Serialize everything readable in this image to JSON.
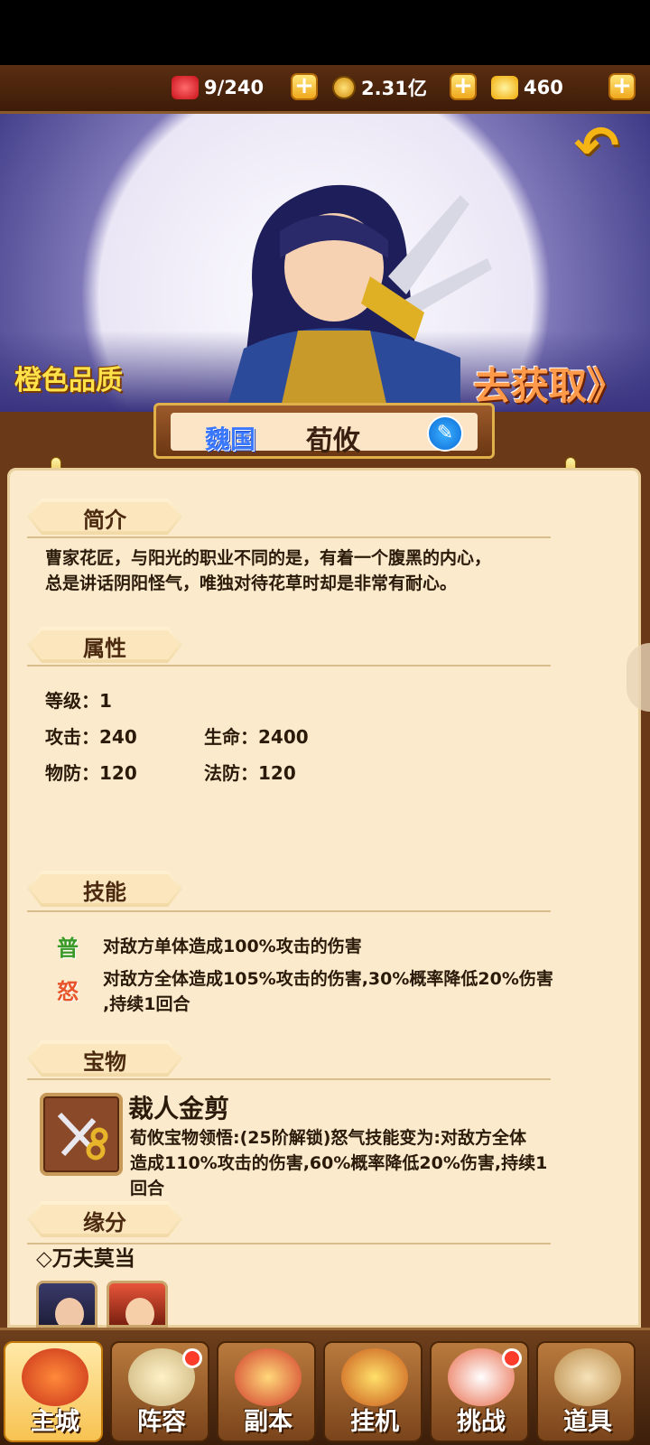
{
  "resources": [
    {
      "icon": "stamina-icon",
      "value": "9/240",
      "color": "#e8232a"
    },
    {
      "icon": "coin-icon",
      "value": "2.31亿",
      "color": "#f2b21a"
    },
    {
      "icon": "ingot-icon",
      "value": "460",
      "color": "#ffc414"
    }
  ],
  "hero": {
    "quality": "橙色品质",
    "get_link": "去获取》",
    "nation": "魏国",
    "name": "荀攸"
  },
  "sections": {
    "intro": "简介",
    "attributes": "属性",
    "skills": "技能",
    "treasure": "宝物",
    "fate": "缘分"
  },
  "intro": {
    "line1": "曹家花匠，与阳光的职业不同的是，有着一个腹黑的内心，",
    "line2": "总是讲话阴阳怪气，唯独对待花草时却是非常有耐心。"
  },
  "attributes": {
    "level": "等级：1",
    "attack": "攻击：240",
    "hp": "生命：2400",
    "pdef": "物防：120",
    "mdef": "法防：120"
  },
  "skills": [
    {
      "icon": "普",
      "text": "对敌方单体造成100%攻击的伤害"
    },
    {
      "icon": "怒",
      "text1": "对敌方全体造成105%攻击的伤害,30%概率降低20%伤害",
      "text2": ",持续1回合"
    }
  ],
  "treasure": {
    "name": "裁人金剪",
    "line1": "荀攸宝物领悟:(25阶解锁)怒气技能变为:对敌方全体",
    "line2": "造成110%攻击的伤害,60%概率降低20%伤害,持续1",
    "line3": "回合"
  },
  "fate": {
    "title": "◇万夫莫当"
  },
  "nav": [
    "主城",
    "阵容",
    "副本",
    "挂机",
    "挑战",
    "道具"
  ]
}
